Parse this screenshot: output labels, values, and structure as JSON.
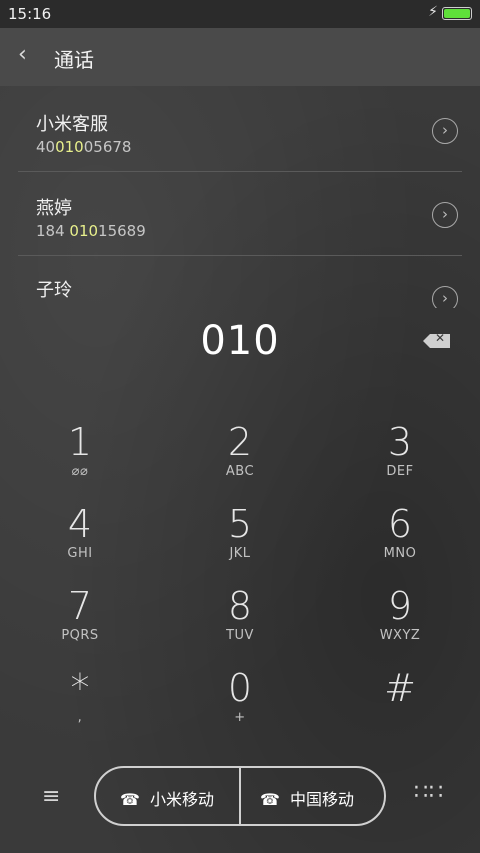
{
  "status_bar": {
    "time": "15:16"
  },
  "header": {
    "title": "通话"
  },
  "contacts": [
    {
      "name": "小米客服",
      "num_pre": "40",
      "num_match": "010",
      "num_post": "05678"
    },
    {
      "name": "燕婷",
      "num_pre": "184 ",
      "num_match": "010",
      "num_post": "15689"
    },
    {
      "name": "子玲"
    }
  ],
  "dialed": "010",
  "keypad": [
    {
      "digit": "1",
      "letters": ""
    },
    {
      "digit": "2",
      "letters": "ABC"
    },
    {
      "digit": "3",
      "letters": "DEF"
    },
    {
      "digit": "4",
      "letters": "GHI"
    },
    {
      "digit": "5",
      "letters": "JKL"
    },
    {
      "digit": "6",
      "letters": "MNO"
    },
    {
      "digit": "7",
      "letters": "PQRS"
    },
    {
      "digit": "8",
      "letters": "TUV"
    },
    {
      "digit": "9",
      "letters": "WXYZ"
    },
    {
      "digit": "*",
      "letters": ","
    },
    {
      "digit": "0",
      "letters": "+"
    },
    {
      "digit": "#",
      "letters": ""
    }
  ],
  "sim1": {
    "label": "小米移动",
    "slot": "1"
  },
  "sim2": {
    "label": "中国移动",
    "slot": "2"
  },
  "icons": {
    "back": "back-arrow-icon",
    "chevron": "chevron-right-circle-icon",
    "backspace": "backspace-icon",
    "menu": "menu-icon",
    "keypad": "keypad-grid-icon",
    "phone": "phone-icon"
  },
  "colors": {
    "match_highlight": "#e8f08c",
    "battery": "#5fe03a"
  }
}
